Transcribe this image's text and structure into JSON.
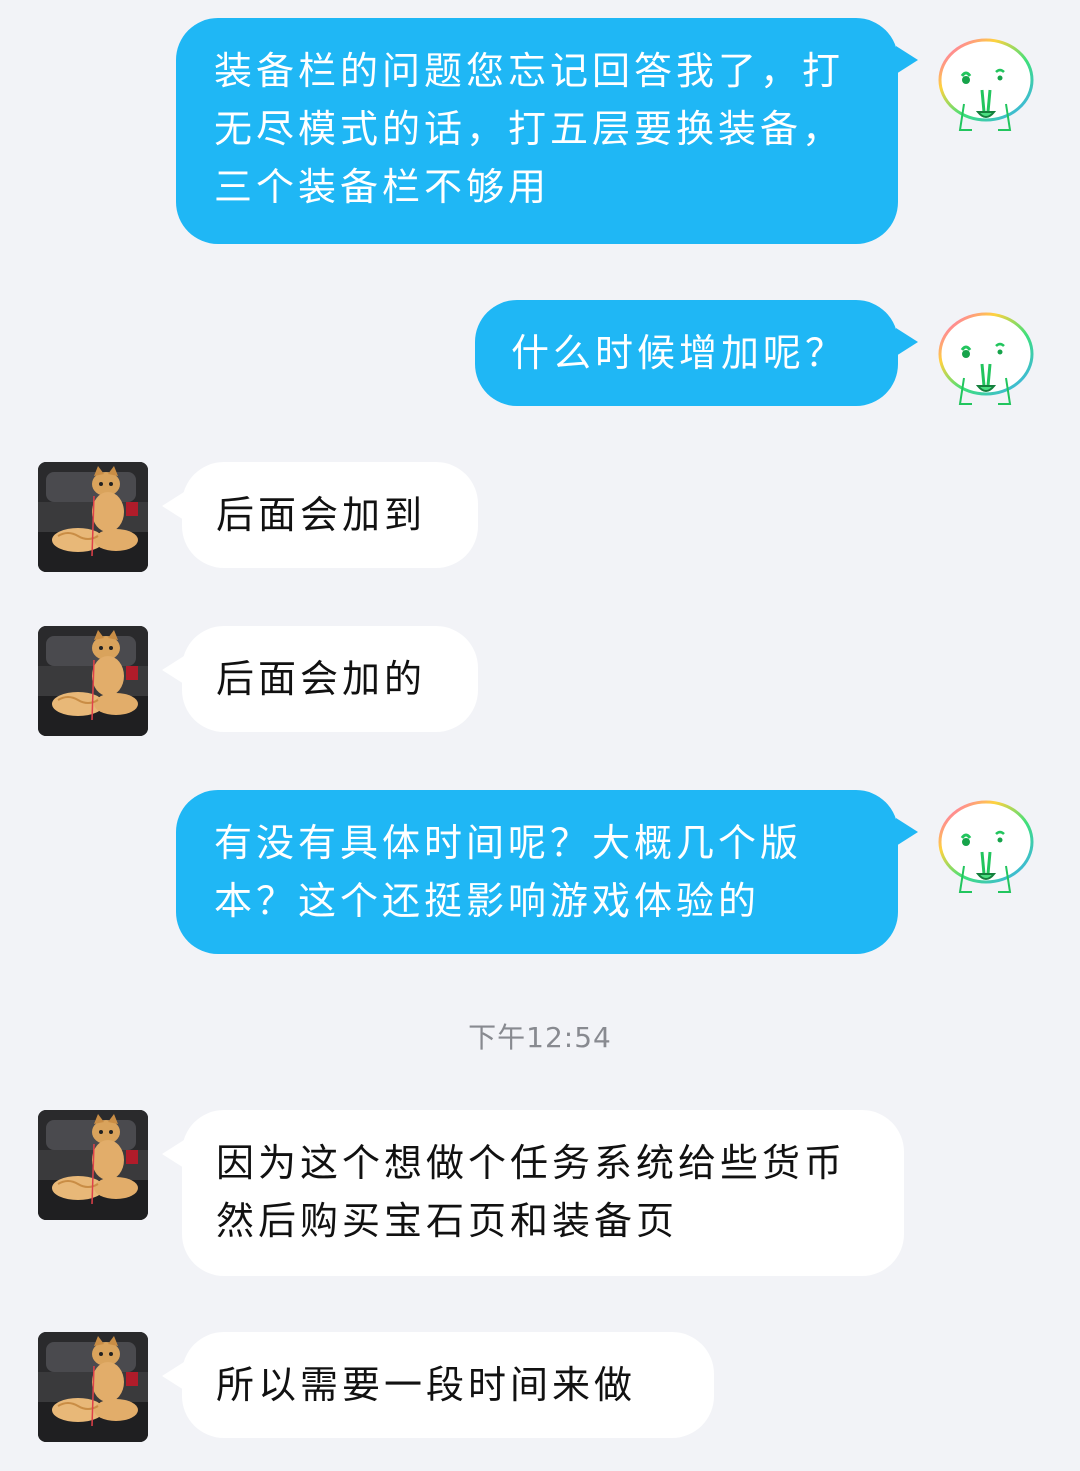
{
  "messages": [
    {
      "side": "out",
      "text": "装备栏的问题您忘记回答我了，打无尽模式的话，打五层要换装备，三个装备栏不够用"
    },
    {
      "side": "out",
      "text": "什么时候增加呢？"
    },
    {
      "side": "in",
      "text": "后面会加到"
    },
    {
      "side": "in",
      "text": "后面会加的"
    },
    {
      "side": "out",
      "text": "有没有具体时间呢？大概几个版本？这个还挺影响游戏体验的"
    },
    {
      "side": "in",
      "text": "因为这个想做个任务系统给些货币 然后购买宝石页和装备页"
    },
    {
      "side": "in",
      "text": "所以需要一段时间来做"
    }
  ],
  "timestamp": "下午12:54",
  "colors": {
    "outgoing_bubble": "#1fb7f5",
    "incoming_bubble": "#ffffff",
    "background": "#f2f3f7"
  },
  "avatars": {
    "self": "rainbow-doodle-face-avatar",
    "contact": "orange-cat-photo-avatar"
  }
}
